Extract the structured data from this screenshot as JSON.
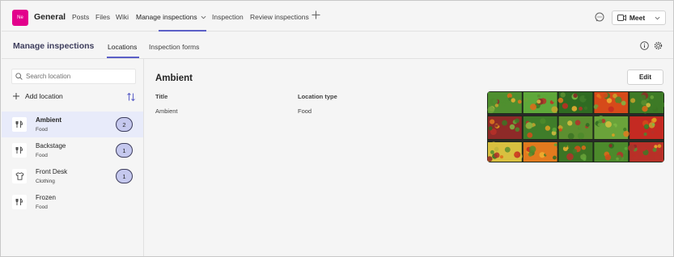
{
  "topbar": {
    "team_initials": "Ne",
    "team_name": "General",
    "tabs": [
      {
        "label": "Posts"
      },
      {
        "label": "Files"
      },
      {
        "label": "Wiki"
      },
      {
        "label": "Manage inspections"
      },
      {
        "label": "Inspection"
      },
      {
        "label": "Review inspections"
      }
    ],
    "active_tab": "Manage inspections",
    "meet_label": "Meet"
  },
  "app": {
    "title": "Manage inspections",
    "tabs": [
      {
        "label": "Locations"
      },
      {
        "label": "Inspection forms"
      }
    ],
    "active_tab": "Locations"
  },
  "sidebar": {
    "search_placeholder": "Search location",
    "add_label": "Add location",
    "locations": [
      {
        "name": "Ambient",
        "type": "Food",
        "count": "2",
        "icon": "cutlery-icon",
        "selected": true
      },
      {
        "name": "Backstage",
        "type": "Food",
        "count": "1",
        "icon": "cutlery-icon",
        "selected": false
      },
      {
        "name": "Front Desk",
        "type": "Clothing",
        "count": "1",
        "icon": "shirt-icon",
        "selected": false
      },
      {
        "name": "Frozen",
        "type": "Food",
        "count": "",
        "icon": "cutlery-icon",
        "selected": false
      }
    ]
  },
  "detail": {
    "title": "Ambient",
    "edit_label": "Edit",
    "columns": [
      {
        "header": "Title",
        "value": "Ambient"
      },
      {
        "header": "Location type",
        "value": "Food"
      }
    ],
    "image_icon": "produce-shelves-photo"
  },
  "colors": {
    "accent": "#5b5fc7",
    "team_avatar": "#e3008c",
    "selected_row": "#e8ebfa",
    "badge_fill": "#c5c8ee"
  }
}
